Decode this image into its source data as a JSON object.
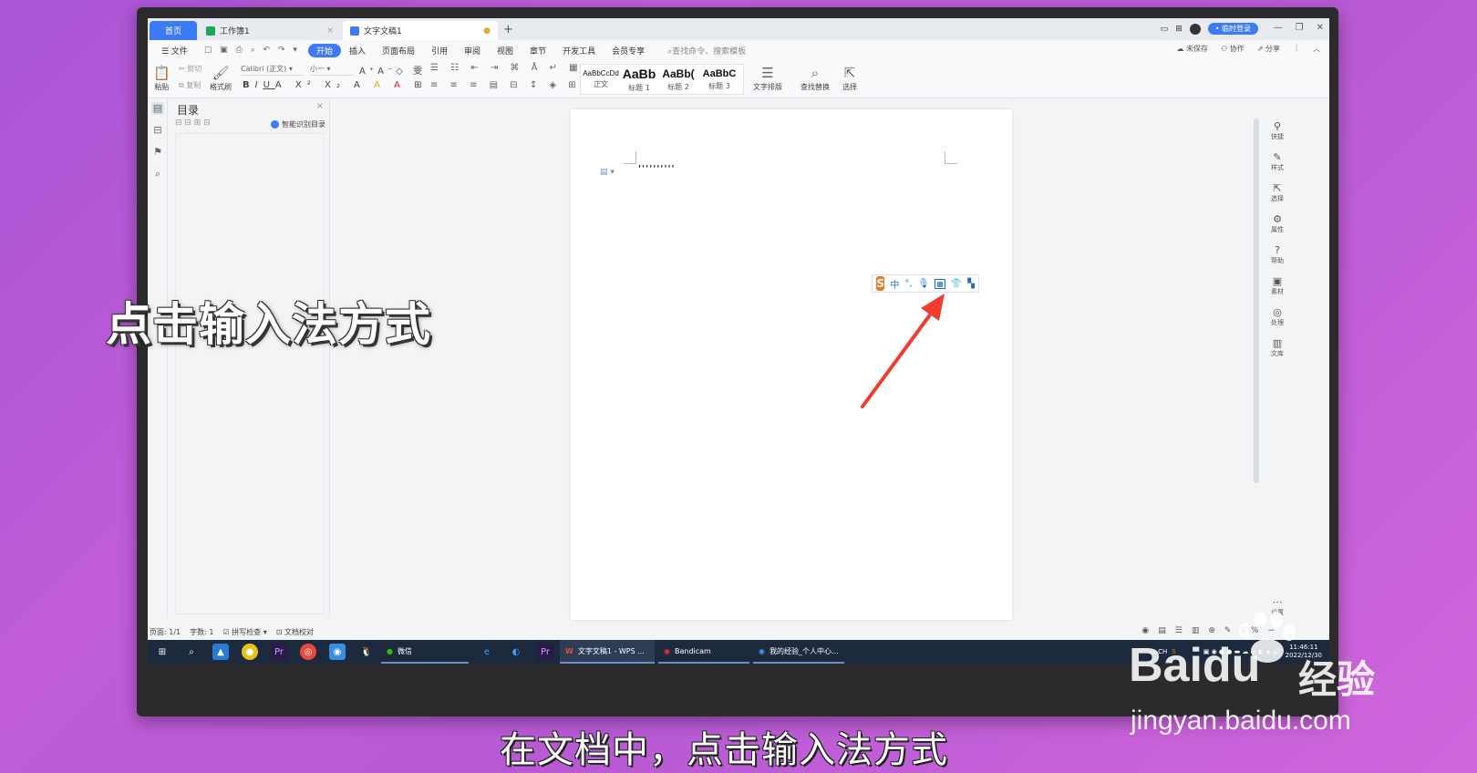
{
  "overlay": {
    "title": "点击输入法方式",
    "subtitle": "在文档中，点击输入法方式"
  },
  "watermark": {
    "logo": "Bai",
    "logo_du": "du",
    "cn": "经验",
    "url": "jingyan.baidu.com"
  },
  "tabs": [
    {
      "label": "首页"
    },
    {
      "label": "工作簿1"
    },
    {
      "label": "文字文稿1"
    }
  ],
  "titlebar": {
    "login": "• 临时登录"
  },
  "menu": {
    "file": "☰ 文件",
    "items": [
      "开始",
      "插入",
      "页面布局",
      "引用",
      "审阅",
      "视图",
      "章节",
      "开发工具",
      "会员专享"
    ],
    "search": "查找命令、搜索模板",
    "right": [
      "未保存",
      "协作",
      "分享"
    ]
  },
  "ribbon": {
    "paste": "粘贴",
    "cut": "剪切",
    "copy": "复制",
    "format_painter": "格式刷",
    "font": "Calibri (正文)",
    "size": "小一",
    "styles": [
      {
        "sample": "AaBbCcDd",
        "label": "正文"
      },
      {
        "sample": "AaBb",
        "label": "标题 1"
      },
      {
        "sample": "AaBb(",
        "label": "标题 2"
      },
      {
        "sample": "AaBbC",
        "label": "标题 3"
      }
    ],
    "text_layout": "文字排版",
    "find_replace": "查找替换",
    "select": "选择"
  },
  "nav": {
    "title": "目录",
    "smart": "智能识别目录"
  },
  "document": {
    "text": "''''''''''"
  },
  "ime": {
    "zh": "中",
    "punct": "°,"
  },
  "right_panel": [
    "快捷",
    "样式",
    "选择",
    "属性",
    "帮助",
    "素材",
    "处理",
    "文库"
  ],
  "right_bottom": "设置",
  "status": {
    "page": "页面: 1/1",
    "words": "字数: 1",
    "spell": "拼写检查",
    "proof": "文档校对",
    "zoom": "93%"
  },
  "taskbar": {
    "wechat": "微信",
    "wps": "文字文稿1 - WPS ...",
    "bandicam": "Bandicam",
    "browser": "我的经验_个人中心...",
    "lang": "CH",
    "time": "11:46:11",
    "date": "2022/12/30"
  }
}
